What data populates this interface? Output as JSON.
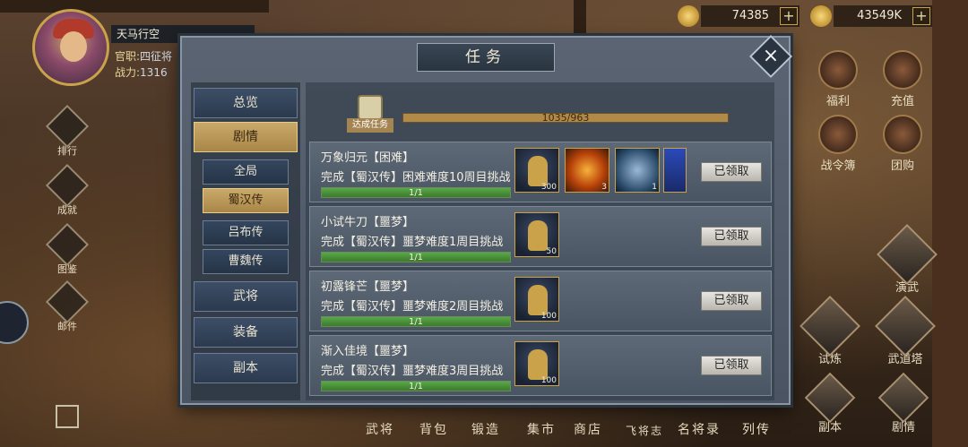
{
  "player": {
    "name": "天马行空",
    "rank_label": "官职:",
    "rank_value": "四征将",
    "power_label": "战力:",
    "power_value": "1316"
  },
  "resources": {
    "gold_ingot": "74385",
    "coins": "43549K",
    "plus": "+"
  },
  "right_menu": {
    "welfare": "福利",
    "recharge": "充值",
    "battle_pass": "战令簿",
    "group_buy": "团购",
    "martial": "演武",
    "trial": "试炼",
    "tower": "武道塔",
    "dungeon": "副本",
    "story": "剧情"
  },
  "left_menu": {
    "ranking": "排行",
    "achievement": "成就",
    "atlas": "图鉴",
    "mail": "邮件"
  },
  "bottom_nav": [
    "武将",
    "背包",
    "锻造",
    "集市",
    "商店",
    "飞将志",
    "名将录",
    "列传"
  ],
  "dialog": {
    "title": "任务",
    "close_icon": "×",
    "tabs": {
      "overview": "总览",
      "story": "剧情",
      "all": "全局",
      "shu": "蜀汉传",
      "lubu": "吕布传",
      "wei": "曹魏传",
      "generals": "武将",
      "equipment": "装备",
      "dungeon": "副本"
    },
    "badge_text": "达成任务",
    "total_progress_text": "1035/963",
    "total_progress_ratio": 1.0,
    "claimed_label": "已领取",
    "quests": [
      {
        "title": "万象归元【困难】",
        "desc": "完成【蜀汉传】困难难度10周目挑战",
        "progress": "1/1",
        "ratio": 1.0,
        "rewards": [
          {
            "kind": "general",
            "count": "300"
          },
          {
            "kind": "fire",
            "count": "3"
          },
          {
            "kind": "blade",
            "count": "1"
          },
          {
            "kind": "book",
            "count": ""
          }
        ]
      },
      {
        "title": "小试牛刀【噩梦】",
        "desc": "完成【蜀汉传】噩梦难度1周目挑战",
        "progress": "1/1",
        "ratio": 1.0,
        "rewards": [
          {
            "kind": "general",
            "count": "50"
          }
        ]
      },
      {
        "title": "初露锋芒【噩梦】",
        "desc": "完成【蜀汉传】噩梦难度2周目挑战",
        "progress": "1/1",
        "ratio": 1.0,
        "rewards": [
          {
            "kind": "general",
            "count": "100"
          }
        ]
      },
      {
        "title": "渐入佳境【噩梦】",
        "desc": "完成【蜀汉传】噩梦难度3周目挑战",
        "progress": "1/1",
        "ratio": 1.0,
        "rewards": [
          {
            "kind": "general",
            "count": "100"
          }
        ]
      }
    ]
  },
  "colors": {
    "accent_gold": "#c9a24a",
    "progress_green": "#5aa84a",
    "dialog_bg": "#5a6472"
  }
}
